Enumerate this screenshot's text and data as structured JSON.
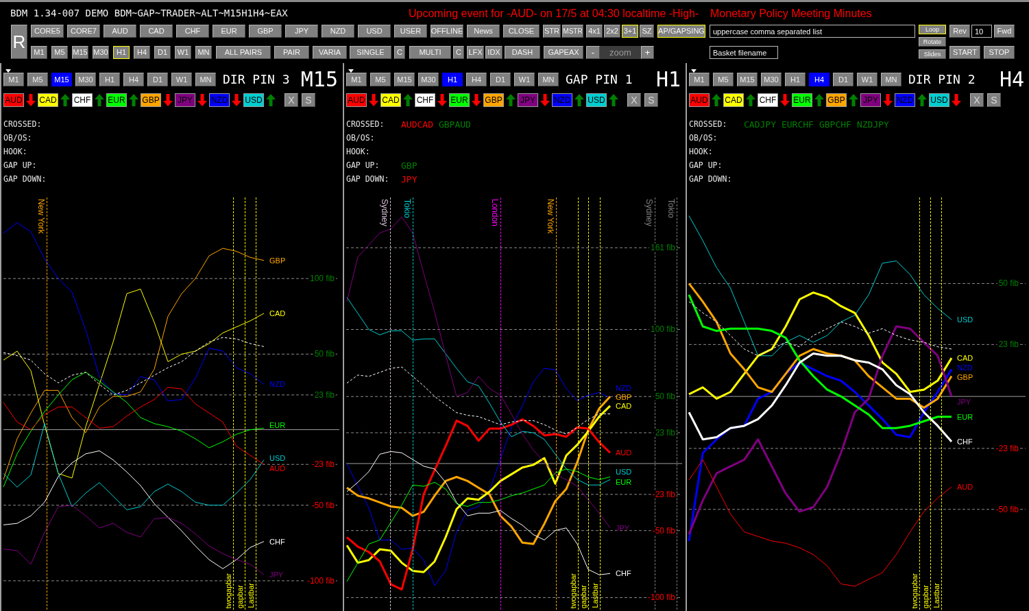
{
  "window": {
    "title": "BDM 1.34-007 DEMO BDM~GAP~TRADER~ALT~M15H1H4~EAX"
  },
  "event": {
    "notice": "Upcoming event for -AUD- on 17/5 at 04:30 localtime -High-",
    "name": "Monetary Policy Meeting Minutes"
  },
  "toolbar": {
    "reset_button": "R",
    "row_1": [
      {
        "label": "CORE5",
        "selected": false
      },
      {
        "label": "CORE7",
        "selected": false
      },
      {
        "label": "AUD",
        "selected": false
      },
      {
        "label": "CAD",
        "selected": false
      },
      {
        "label": "CHF",
        "selected": false
      },
      {
        "label": "EUR",
        "selected": false
      },
      {
        "label": "GBP",
        "selected": false
      },
      {
        "label": "JPY",
        "selected": false
      },
      {
        "label": "NZD",
        "selected": false
      },
      {
        "label": "USD",
        "selected": false
      },
      {
        "label": "USER",
        "selected": false
      },
      {
        "label": "OFFLINE",
        "selected": false
      },
      {
        "label": "News",
        "selected": false
      },
      {
        "label": "CLOSE",
        "selected": false
      },
      {
        "label": "STR",
        "selected": false
      },
      {
        "label": "MSTR",
        "selected": false
      },
      {
        "label": "4x1",
        "selected": false
      },
      {
        "label": "2x2",
        "selected": false
      },
      {
        "label": "3+1",
        "selected": true
      },
      {
        "label": "SZ",
        "selected": false
      },
      {
        "label": "AP/GAPSING",
        "selected": true
      }
    ],
    "row_2": [
      {
        "label": "M1",
        "selected": false
      },
      {
        "label": "M5",
        "selected": false
      },
      {
        "label": "M15",
        "selected": false
      },
      {
        "label": "M30",
        "selected": false
      },
      {
        "label": "H1",
        "selected": true
      },
      {
        "label": "H4",
        "selected": false
      },
      {
        "label": "D1",
        "selected": false
      },
      {
        "label": "W1",
        "selected": false
      },
      {
        "label": "MN",
        "selected": false
      },
      {
        "label": "ALL PAIRS",
        "selected": false
      },
      {
        "label": "PAIR",
        "selected": false
      },
      {
        "label": "VARIA",
        "selected": false
      },
      {
        "label": "SINGLE",
        "selected": false
      },
      {
        "label": "C",
        "selected": false
      },
      {
        "label": "MULTI",
        "selected": false
      },
      {
        "label": "C",
        "selected": false
      },
      {
        "label": "LFX",
        "selected": false
      },
      {
        "label": "IDX",
        "selected": false
      },
      {
        "label": "DASH",
        "selected": false
      },
      {
        "label": "GAPEAX",
        "selected": false
      }
    ],
    "zoom": {
      "minus": "-",
      "placeholder": "zoom",
      "plus": "+"
    },
    "pairs_field": {
      "placeholder": "uppercase comma separated list"
    },
    "basket_field": {
      "placeholder": "Basket filename"
    },
    "slide_modes": [
      {
        "label": "Loop",
        "selected": true
      },
      {
        "label": "Rotate",
        "selected": false
      },
      {
        "label": "Slides",
        "selected": false
      }
    ],
    "rev_button": "Rev",
    "step_field": {
      "value": "10"
    },
    "fwd_button": "Fwd",
    "start_button": "START",
    "stop_button": "STOP"
  },
  "panels": [
    {
      "timeframes": [
        {
          "label": "M1",
          "selected": false
        },
        {
          "label": "M5",
          "selected": false
        },
        {
          "label": "M15",
          "selected": true
        },
        {
          "label": "M30",
          "selected": false
        },
        {
          "label": "H1",
          "selected": false
        },
        {
          "label": "H4",
          "selected": false
        },
        {
          "label": "D1",
          "selected": false
        },
        {
          "label": "W1",
          "selected": false
        },
        {
          "label": "MN",
          "selected": false
        }
      ],
      "title": "DIR PIN 3",
      "timeframe": "M15",
      "currencies": [
        {
          "code": "AUD",
          "color": "#ff0000",
          "rising": false
        },
        {
          "code": "CAD",
          "color": "#ffff00",
          "rising": true
        },
        {
          "code": "CHF",
          "color": "#ffffff",
          "rising": true
        },
        {
          "code": "EUR",
          "color": "#00ff00",
          "rising": true
        },
        {
          "code": "GBP",
          "color": "#ffa500",
          "rising": false
        },
        {
          "code": "JPY",
          "color": "#800080",
          "rising": false
        },
        {
          "code": "NZD",
          "color": "#0000ff",
          "rising": false
        },
        {
          "code": "USD",
          "color": "#00ced1",
          "rising": true
        }
      ],
      "actions": [
        "X",
        "S"
      ],
      "signals": [
        {
          "label": "CROSSED:"
        },
        {
          "label": "OB/OS:"
        },
        {
          "label": "HOOK:"
        },
        {
          "label": "GAP UP:"
        },
        {
          "label": "GAP DOWN:"
        }
      ],
      "sessions": [
        {
          "label": "New York",
          "color": "#ffa500"
        }
      ],
      "bar_markers": [
        "twogapbar",
        "gapbar",
        "Lastbar"
      ],
      "chart_data": [
        {
          "type": "line",
          "categories": [
            null,
            null,
            null,
            null,
            null,
            null,
            null,
            null,
            null,
            null,
            null,
            null,
            null,
            null,
            null,
            null,
            null,
            null,
            null,
            null
          ],
          "ylim": [
            -120,
            155
          ],
          "yticks": [
            {
              "value": 100,
              "label": "100 fib"
            },
            {
              "value": 50,
              "label": "50 fib"
            },
            {
              "value": 23,
              "label": "23 fib"
            },
            {
              "value": -23,
              "label": "-23 fib"
            },
            {
              "value": -50,
              "label": "-50 fib"
            },
            {
              "value": -100,
              "label": "-100 fib"
            }
          ],
          "grid": true,
          "series": [
            {
              "name": "GBP",
              "color": "#ffa500",
              "values": [
                -33,
                -6,
                11,
                26,
                26,
                8,
                -2,
                15,
                22,
                22,
                25,
                40,
                75,
                90,
                100,
                115,
                120,
                118,
                114,
                112
              ]
            },
            {
              "name": "CAD",
              "color": "#ffff00",
              "values": [
                46,
                52,
                39,
                3,
                -29,
                -32,
                2,
                30,
                58,
                90,
                93,
                71,
                45,
                50,
                52,
                57,
                64,
                68,
                72,
                77
              ]
            },
            {
              "name": "NZD",
              "color": "#0000ff",
              "values": [
                130,
                137,
                131,
                113,
                100,
                91,
                66,
                35,
                24,
                23,
                35,
                33,
                19,
                20,
                34,
                54,
                52,
                41,
                37,
                30
              ]
            },
            {
              "name": "EUR",
              "color": "#00ff00",
              "values": [
                -38,
                -16,
                -1,
                12,
                23,
                33,
                38,
                32,
                25,
                18,
                8,
                4,
                2,
                -1,
                -6,
                -12,
                -8,
                -3,
                0,
                1
              ]
            },
            {
              "name": "USD",
              "color": "#00ced1",
              "values": [
                -29,
                -38,
                -30,
                4,
                -29,
                -51,
                -42,
                -35,
                -44,
                -53,
                -51,
                -41,
                -36,
                -41,
                -48,
                -50,
                -50,
                -42,
                -33,
                -20
              ]
            },
            {
              "name": "AUD",
              "color": "#ff0000",
              "values": [
                18,
                5,
                0,
                10,
                15,
                15,
                8,
                1,
                2,
                9,
                15,
                20,
                28,
                27,
                17,
                11,
                5,
                -11,
                -17,
                -23
              ]
            },
            {
              "name": "CHF",
              "color": "#ffffff",
              "values": [
                -63,
                -62,
                -57,
                -48,
                -31,
                -22,
                -16,
                -14,
                -20,
                -28,
                -37,
                -49,
                -58,
                -67,
                -77,
                -86,
                -92,
                -86,
                -78,
                -74
              ]
            },
            {
              "name": "JPY",
              "color": "#800080",
              "values": [
                -79,
                -80,
                -89,
                -68,
                -51,
                -50,
                -57,
                -65,
                -62,
                -68,
                -71,
                -59,
                -58,
                -62,
                -69,
                -77,
                -82,
                -86,
                -89,
                -96
              ]
            },
            {
              "color": "#ffffff",
              "line_style": "dashed",
              "values": [
                51,
                49,
                46,
                37,
                31,
                36,
                38,
                30,
                23,
                26,
                31,
                36,
                41,
                45,
                52,
                58,
                61,
                60,
                57,
                55
              ]
            }
          ],
          "ref_lines": [
            {
              "axis": "y",
              "value": 0,
              "color": "#a0a0a0",
              "line_style": "solid"
            }
          ]
        }
      ]
    },
    {
      "timeframes": [
        {
          "label": "M1",
          "selected": false
        },
        {
          "label": "M5",
          "selected": false
        },
        {
          "label": "M15",
          "selected": false
        },
        {
          "label": "M30",
          "selected": false
        },
        {
          "label": "H1",
          "selected": true
        },
        {
          "label": "H4",
          "selected": false
        },
        {
          "label": "D1",
          "selected": false
        },
        {
          "label": "W1",
          "selected": false
        },
        {
          "label": "MN",
          "selected": false
        }
      ],
      "title": "GAP PIN 1",
      "timeframe": "H1",
      "currencies": [
        {
          "code": "AUD",
          "color": "#ff0000",
          "rising": false
        },
        {
          "code": "CAD",
          "color": "#ffff00",
          "rising": true
        },
        {
          "code": "CHF",
          "color": "#ffffff",
          "rising": false
        },
        {
          "code": "EUR",
          "color": "#00ff00",
          "rising": false
        },
        {
          "code": "GBP",
          "color": "#ffa500",
          "rising": true
        },
        {
          "code": "JPY",
          "color": "#800080",
          "rising": false
        },
        {
          "code": "NZD",
          "color": "#0000ff",
          "rising": true
        },
        {
          "code": "USD",
          "color": "#00ced1",
          "rising": true
        }
      ],
      "actions": [
        "X",
        "S"
      ],
      "signals": [
        {
          "label": "CROSSED:",
          "items": [
            {
              "text": "AUDCAD",
              "color": "#ff0000"
            },
            {
              "text": "GBPAUD",
              "color": "#008000"
            }
          ]
        },
        {
          "label": "OB/OS:"
        },
        {
          "label": "HOOK:"
        },
        {
          "label": "GAP UP:",
          "items": [
            {
              "text": "GBP",
              "color": "#008000"
            }
          ]
        },
        {
          "label": "GAP DOWN:",
          "items": [
            {
              "text": "JPY",
              "color": "#ff0000"
            }
          ]
        }
      ],
      "sessions": [
        {
          "label": "Sydney",
          "color": "#d8bfd8"
        },
        {
          "label": "Tokio",
          "color": "#00ced1"
        },
        {
          "label": "London",
          "color": "#ff00ff"
        },
        {
          "label": "New York",
          "color": "#ffa500"
        },
        {
          "label": "Sydney",
          "color": "#808080"
        },
        {
          "label": "Tokio",
          "color": "#808080"
        }
      ],
      "bar_markers": [
        "twogapbar",
        "gapbar",
        "Lastbar"
      ],
      "chart_data": [
        {
          "type": "line",
          "categories": [
            null,
            null,
            null,
            null,
            null,
            null,
            null,
            null,
            null,
            null,
            null,
            null,
            null,
            null,
            null,
            null,
            null,
            null,
            null,
            null,
            null,
            null,
            null,
            null,
            null
          ],
          "ylim": [
            -110,
            200
          ],
          "yticks": [
            {
              "value": 161,
              "label": "161 fib"
            },
            {
              "value": 100,
              "label": "100 fib"
            },
            {
              "value": 50,
              "label": "50 fib"
            },
            {
              "value": 23,
              "label": "23 fib"
            },
            {
              "value": -23,
              "label": "-23 fib"
            },
            {
              "value": -50,
              "label": "-50 fib"
            },
            {
              "value": -100,
              "label": "-100 fib"
            }
          ],
          "grid": true,
          "series": [
            {
              "name": "NZD",
              "color": "#0000ff",
              "values": [
                0,
                -17,
                -33,
                -57,
                -57,
                -64,
                -63,
                -72,
                -91,
                -80,
                -51,
                -35,
                -32,
                -20,
                3,
                27,
                43,
                61,
                71,
                70,
                56,
                47,
                51,
                53,
                49
              ]
            },
            {
              "name": "GBP",
              "color": "#ffa500",
              "values": [
                -18,
                -24,
                -26,
                -29,
                -32,
                -33,
                -39,
                -36,
                -24,
                -13,
                -10,
                -13,
                -18,
                -23,
                -39,
                -47,
                -59,
                -60,
                -45,
                -28,
                -19,
                1,
                25,
                41,
                50
              ]
            },
            {
              "name": "CAD",
              "color": "#ffff00",
              "values": [
                -61,
                -74,
                -72,
                -64,
                -65,
                -74,
                -80,
                -81,
                -73,
                -55,
                -34,
                -26,
                -27,
                -21,
                -13,
                -8,
                -3,
                -1,
                4,
                -15,
                6,
                14,
                24,
                35,
                43
              ]
            },
            {
              "name": "AUD",
              "color": "#ff0000",
              "values": [
                -55,
                -62,
                -66,
                -73,
                -90,
                -94,
                -64,
                -23,
                -5,
                13,
                32,
                28,
                17,
                26,
                26,
                29,
                33,
                28,
                21,
                22,
                20,
                27,
                26,
                16,
                8
              ]
            },
            {
              "name": "USD",
              "color": "#00ced1",
              "values": [
                124,
                112,
                100,
                96,
                99,
                99,
                92,
                93,
                93,
                82,
                71,
                61,
                58,
                45,
                31,
                20,
                24,
                23,
                18,
                7,
                -4,
                -12,
                -16,
                -16,
                -12
              ]
            },
            {
              "name": "EUR",
              "color": "#00ff00",
              "values": [
                -88,
                -74,
                -60,
                -57,
                -44,
                -31,
                -16,
                -17,
                -14,
                -19,
                -30,
                -32,
                -29,
                -29,
                -27,
                -24,
                -22,
                -19,
                -16,
                -7,
                -4,
                -6,
                -10,
                -12,
                -10
              ]
            },
            {
              "name": "JPY",
              "color": "#800080",
              "values": [
                121,
                154,
                163,
                172,
                175,
                184,
                172,
                142,
                113,
                81,
                50,
                53,
                65,
                56,
                51,
                37,
                22,
                10,
                1,
                -8,
                -12,
                -17,
                -27,
                -37,
                -48
              ]
            },
            {
              "name": "CHF",
              "color": "#ffffff",
              "values": [
                -21,
                -14,
                -6,
                7,
                9,
                8,
                3,
                -2,
                -4,
                -14,
                -29,
                -39,
                -37,
                -37,
                -35,
                -41,
                -46,
                -53,
                -57,
                -50,
                -48,
                -60,
                -79,
                -83,
                -82
              ]
            },
            {
              "color": "#ffffff",
              "line_style": "dashed",
              "values": [
                60,
                66,
                65,
                68,
                71,
                72,
                65,
                58,
                50,
                44,
                38,
                36,
                35,
                32,
                29,
                31,
                32,
                32,
                29,
                25,
                22,
                27,
                33,
                37,
                37
              ]
            }
          ],
          "ref_lines": [
            {
              "axis": "y",
              "value": 0,
              "color": "#a0a0a0",
              "line_style": "solid"
            }
          ]
        }
      ]
    },
    {
      "timeframes": [
        {
          "label": "M1",
          "selected": false
        },
        {
          "label": "M5",
          "selected": false
        },
        {
          "label": "M15",
          "selected": false
        },
        {
          "label": "M30",
          "selected": false
        },
        {
          "label": "H1",
          "selected": false
        },
        {
          "label": "H4",
          "selected": true
        },
        {
          "label": "D1",
          "selected": false
        },
        {
          "label": "W1",
          "selected": false
        },
        {
          "label": "MN",
          "selected": false
        }
      ],
      "title": "DIR PIN 2",
      "timeframe": "H4",
      "currencies": [
        {
          "code": "AUD",
          "color": "#ff0000",
          "rising": true
        },
        {
          "code": "CAD",
          "color": "#ffff00",
          "rising": true
        },
        {
          "code": "CHF",
          "color": "#ffffff",
          "rising": false
        },
        {
          "code": "EUR",
          "color": "#00ff00",
          "rising": true
        },
        {
          "code": "GBP",
          "color": "#ffa500",
          "rising": true
        },
        {
          "code": "JPY",
          "color": "#800080",
          "rising": false
        },
        {
          "code": "NZD",
          "color": "#0000ff",
          "rising": true
        },
        {
          "code": "USD",
          "color": "#00ced1",
          "rising": false
        }
      ],
      "actions": [
        "X",
        "S"
      ],
      "signals": [
        {
          "label": "CROSSED:",
          "items": [
            {
              "text": "CADJPY",
              "color": "#008000"
            },
            {
              "text": "EURCHF",
              "color": "#008000"
            },
            {
              "text": "GBPCHF",
              "color": "#008000"
            },
            {
              "text": "NZDJPY",
              "color": "#008000"
            }
          ]
        },
        {
          "label": "OB/OS:"
        },
        {
          "label": "HOOK:"
        },
        {
          "label": "GAP UP:"
        },
        {
          "label": "GAP DOWN:"
        }
      ],
      "bar_markers": [
        "twogapbar",
        "gapbar",
        "Lastbar"
      ],
      "chart_data": [
        {
          "type": "line",
          "categories": [
            null,
            null,
            null,
            null,
            null,
            null,
            null,
            null,
            null,
            null,
            null,
            null,
            null,
            null,
            null,
            null,
            null,
            null,
            null,
            null
          ],
          "ylim": [
            -95,
            89
          ],
          "yticks": [
            {
              "value": 50,
              "label": "50 fib"
            },
            {
              "value": 23,
              "label": "23 fib"
            },
            {
              "value": -23,
              "label": "-23 fib"
            },
            {
              "value": -50,
              "label": "-50 fib"
            }
          ],
          "grid": true,
          "series": [
            {
              "name": "USD",
              "color": "#00ced1",
              "values": [
                80,
                69,
                57,
                48,
                33,
                18,
                18,
                24,
                27,
                24,
                27,
                33,
                36,
                45,
                59,
                60,
                54,
                45,
                39,
                34
              ]
            },
            {
              "name": "CAD",
              "color": "#ffff00",
              "values": [
                1,
                4,
                -1,
                2,
                10,
                18,
                21,
                31,
                43,
                46,
                44,
                40,
                37,
                27,
                15,
                10,
                2,
                3,
                7,
                17
              ]
            },
            {
              "name": "NZD",
              "color": "#0000ff",
              "values": [
                -64,
                -25,
                -19,
                -14,
                -13,
                -1,
                2,
                10,
                15,
                12,
                9,
                7,
                2,
                -4,
                -10,
                -17,
                -18,
                -7,
                2,
                12
              ]
            },
            {
              "name": "GBP",
              "color": "#ffa500",
              "values": [
                50,
                42,
                33,
                19,
                12,
                4,
                2,
                10,
                18,
                21,
                19,
                18,
                16,
                9,
                4,
                -1,
                -1,
                -5,
                -1,
                9
              ]
            },
            {
              "name": "JPY",
              "color": "#800080",
              "values": [
                -61,
                -46,
                -34,
                -31,
                -28,
                -19,
                -31,
                -43,
                -51,
                -49,
                -40,
                -25,
                -7,
                -1,
                18,
                31,
                30,
                24,
                18,
                0
              ]
            },
            {
              "name": "EUR",
              "color": "#00ff00",
              "values": [
                45,
                31,
                29,
                30,
                30,
                30,
                29,
                26,
                16,
                9,
                3,
                0,
                -4,
                -8,
                -14,
                -14,
                -13,
                -11,
                -9,
                -9
              ]
            },
            {
              "name": "CHF",
              "color": "#ffffff",
              "values": [
                -7,
                -19,
                -18,
                -14,
                -13,
                -10,
                -4,
                5,
                15,
                19,
                18,
                18,
                16,
                15,
                12,
                5,
                1,
                -7,
                -13,
                -20
              ]
            },
            {
              "name": "AUD",
              "color": "#ff0000",
              "values": [
                -37,
                -28,
                -40,
                -52,
                -60,
                -62,
                -64,
                -65,
                -67,
                -70,
                -75,
                -83,
                -84,
                -81,
                -78,
                -70,
                -60,
                -51,
                -45,
                -40
              ]
            },
            {
              "color": "#ffffff",
              "line_style": "dashed",
              "values": [
                42,
                37,
                33,
                27,
                21,
                18,
                21,
                24,
                22,
                27,
                30,
                33,
                31,
                28,
                30,
                27,
                25,
                24,
                22,
                21
              ]
            }
          ],
          "ref_lines": [
            {
              "axis": "y",
              "value": 0,
              "color": "#a0a0a0",
              "line_style": "solid"
            }
          ]
        }
      ]
    }
  ]
}
